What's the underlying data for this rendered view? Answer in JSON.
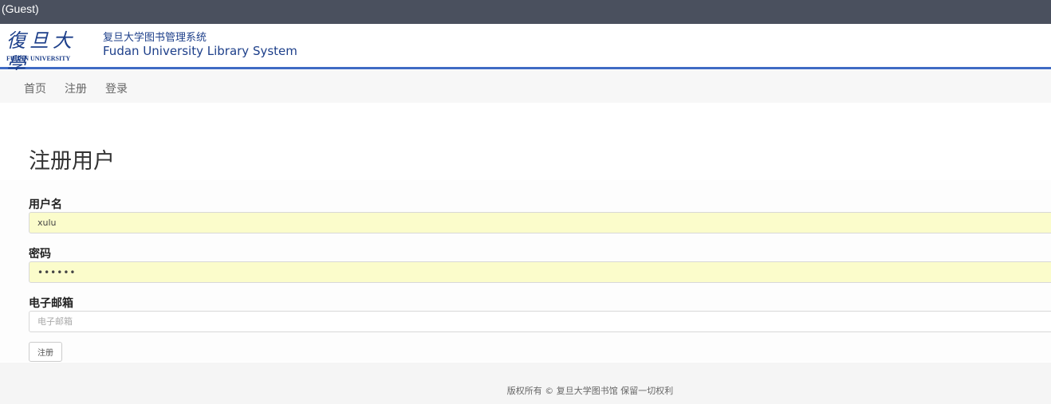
{
  "topbar": {
    "user_label": "(Guest)"
  },
  "header": {
    "logo_calligraphy": "復旦大學",
    "logo_english": "FUDAN UNIVERSITY",
    "title_cn": "复旦大学图书管理系统",
    "title_en": "Fudan University Library System",
    "accent_color": "#3f6bc4"
  },
  "nav": {
    "items": [
      {
        "label": "首页"
      },
      {
        "label": "注册"
      },
      {
        "label": "登录"
      }
    ]
  },
  "form": {
    "title": "注册用户",
    "username": {
      "label": "用户名",
      "value": "xulu"
    },
    "password": {
      "label": "密码",
      "value": "••••••"
    },
    "email": {
      "label": "电子邮箱",
      "placeholder": "电子邮箱",
      "value": ""
    },
    "submit_label": "注册"
  },
  "footer": {
    "text": "版权所有 © 复旦大学图书馆 保留一切权利"
  }
}
